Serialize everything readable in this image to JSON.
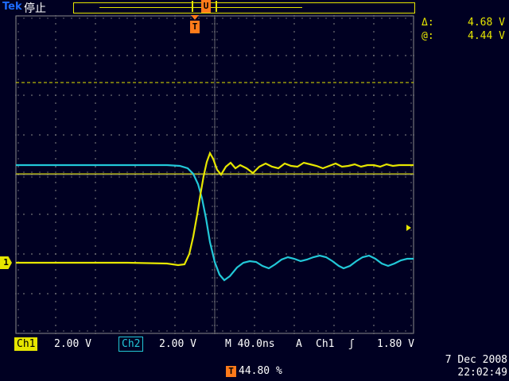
{
  "header": {
    "brand": "Tek",
    "status": "停止",
    "trigger_pos_marker": "U",
    "trigger_marker": "T"
  },
  "readouts": {
    "delta_label": "Δ:",
    "delta_value": "4.68 V",
    "at_label": "@:",
    "at_value": "4.44 V"
  },
  "channel_markers": {
    "ch1": "1"
  },
  "bottom": {
    "ch1_label": "Ch1",
    "ch1_scale": "2.00 V",
    "ch2_label": "Ch2",
    "ch2_scale": "2.00 V",
    "timebase": "M 40.0ns",
    "trigger_mode": "A",
    "trigger_source": "Ch1",
    "trigger_slope": "ʃ",
    "trigger_level": "1.80 V",
    "trigger_position": "44.80 %"
  },
  "datetime": {
    "date": "7 Dec  2008",
    "time": "22:02:49"
  },
  "colors": {
    "background": "#000022",
    "grid": "#8a8a8a",
    "ch1": "#e6e600",
    "ch2": "#22c8d8",
    "trigger": "#ff7a1a"
  }
}
